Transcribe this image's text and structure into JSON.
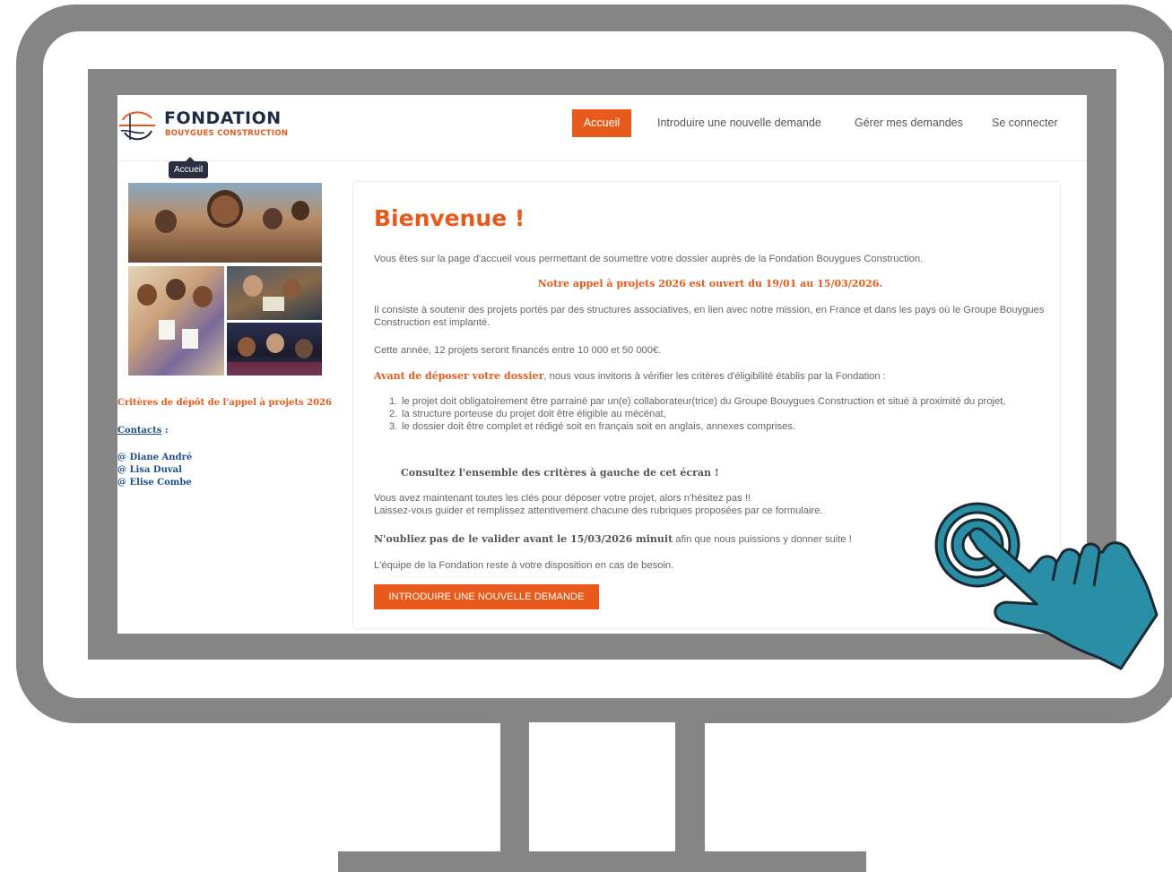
{
  "site": {
    "logo": {
      "title": "FONDATION",
      "subtitle": "BOUYGUES CONSTRUCTION"
    },
    "nav": {
      "accueil": "Accueil",
      "introduire": "Introduire une nouvelle demande",
      "gerer": "Gérer mes demandes",
      "connecter": "Se connecter"
    },
    "tooltip": "Accueil",
    "sidebar": {
      "criteria_link": "Critères de dépôt de l'appel à projets 2026",
      "contacts_label": "Contacts",
      "contacts_colon": " :",
      "contacts": [
        "@ Diane André",
        "@ Lisa Duval",
        "@ Elise Combe"
      ]
    },
    "main": {
      "title": "Bienvenue !",
      "intro": "Vous êtes sur la page d'accueil vous permettant de soumettre votre dossier auprès de la Fondation Bouygues Construction.",
      "appel": "Notre appel à projets 2026 est ouvert du 19/01 au 15/03/2026.",
      "consiste": "Il consiste à soutenir des projets portés par des structures associatives, en lien avec notre mission, en France et dans les pays où le Groupe Bouygues Construction est implanté.",
      "annee": "Cette année, 12 projets seront financés entre 10 000 et 50 000€.",
      "avant_bold": "Avant de déposer votre dossier",
      "avant_rest": ", nous vous invitons à vérifier les critères d'éligibilité établis par la Fondation :",
      "criteria": [
        {
          "num": "1.",
          "text": "le projet doit obligatoirement être parrainé par un(e) collaborateur(trice) du Groupe Bouygues Construction et situé à proximité du projet,"
        },
        {
          "num": "2.",
          "text": "la structure porteuse du projet doit être éligible au mécénat,"
        },
        {
          "num": "3.",
          "text": "le dossier doit être complet et rédigé soit en français soit en anglais, annexes comprises."
        }
      ],
      "consultez": "Consultez l'ensemble des critères à gauche de cet écran !",
      "cles_line1": "Vous avez maintenant toutes les clés pour déposer votre projet, alors n'hésitez pas !!",
      "cles_line2": "Laissez-vous guider et remplissez attentivement chacune des rubriques proposées par ce formulaire.",
      "valider_bold": "N'oubliez pas de le valider avant le 15/03/2026 minuit",
      "valider_rest": " afin que nous puissions y donner suite !",
      "equipe": "L'équipe de la Fondation reste à votre disposition en cas de besoin.",
      "cta": "INTRODUIRE UNE NOUVELLE DEMANDE"
    }
  },
  "colors": {
    "accent": "#e85a1b",
    "frame_gray": "#858585",
    "link_blue": "#1f4e8c",
    "hand_teal": "#2a8fa6",
    "hand_outline": "#1a2a33"
  },
  "icons": {
    "hand": "pointing-hand-tap-icon",
    "logo": "fondation-logo-icon"
  }
}
